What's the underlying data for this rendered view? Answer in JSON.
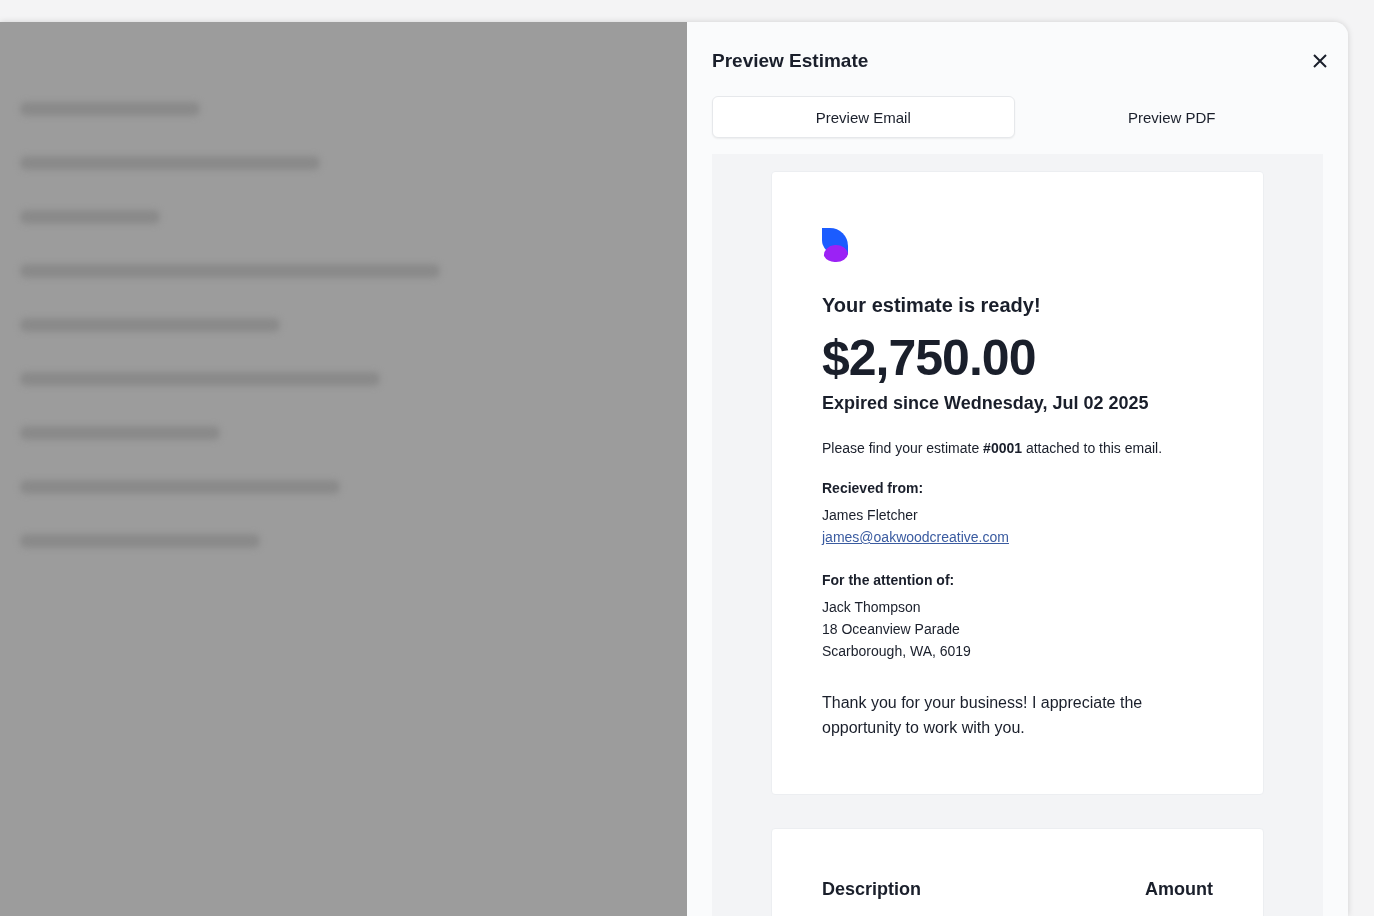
{
  "dialog": {
    "title": "Preview Estimate"
  },
  "tabs": [
    {
      "label": "Preview Email",
      "selected": true
    },
    {
      "label": "Preview PDF",
      "selected": false
    }
  ],
  "email": {
    "heading": "Your estimate is ready!",
    "amount": "$2,750.00",
    "expiry": "Expired since Wednesday, Jul 02 2025",
    "message": "Please find your estimate **#0001** attached to this email.",
    "sections": [
      {
        "title": "Recieved from:",
        "lines": [
          {
            "text": "James Fletcher",
            "kind": "text"
          },
          {
            "text": "james@oakwoodcreative.com",
            "kind": "link"
          }
        ]
      },
      {
        "title": "For the attention of:",
        "lines": [
          {
            "text": "Jack Thompson",
            "kind": "text"
          },
          {
            "text": "18 Oceanview Parade",
            "kind": "text"
          },
          {
            "text": "Scarborough, WA, 6019",
            "kind": "text"
          }
        ]
      }
    ],
    "closing": "Thank you for your business! I appreciate the opportunity to work with you."
  },
  "items_table": {
    "columns": [
      "Description",
      "Amount"
    ]
  }
}
